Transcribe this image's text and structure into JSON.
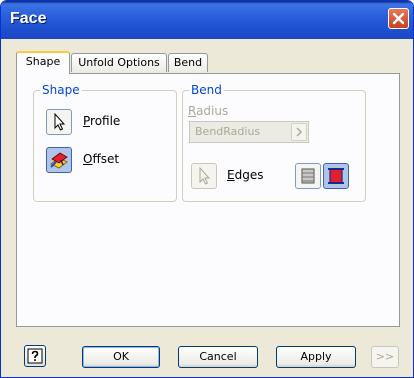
{
  "window": {
    "title": "Face"
  },
  "tabs": [
    {
      "label": "Shape",
      "active": true
    },
    {
      "label": "Unfold Options",
      "active": false
    },
    {
      "label": "Bend",
      "active": false
    }
  ],
  "shape_group": {
    "legend": "Shape",
    "profile_label_accel": "P",
    "profile_label_rest": "rofile",
    "offset_label_accel": "O",
    "offset_label_rest": "ffset"
  },
  "bend_group": {
    "legend": "Bend",
    "radius_label_accel": "R",
    "radius_label_rest": "adius",
    "radius_value": "BendRadius",
    "edges_label_accel": "E",
    "edges_label_rest": "dges"
  },
  "buttons": {
    "ok": "OK",
    "cancel": "Cancel",
    "apply": "Apply",
    "more": ">>"
  },
  "colors": {
    "title_bar": "#2a5fdc",
    "group_legend": "#0046d5",
    "active_tab_accent": "#ffc83c",
    "close_button": "#d4552f"
  },
  "icons": {
    "close": "close-icon",
    "profile": "cursor-arrow-icon",
    "offset": "offset-face-icon",
    "edges": "cursor-arrow-icon",
    "bend_extent_1": "bend-extent-icon",
    "bend_extent_2": "bend-extent-active-icon",
    "help": "help-icon"
  }
}
